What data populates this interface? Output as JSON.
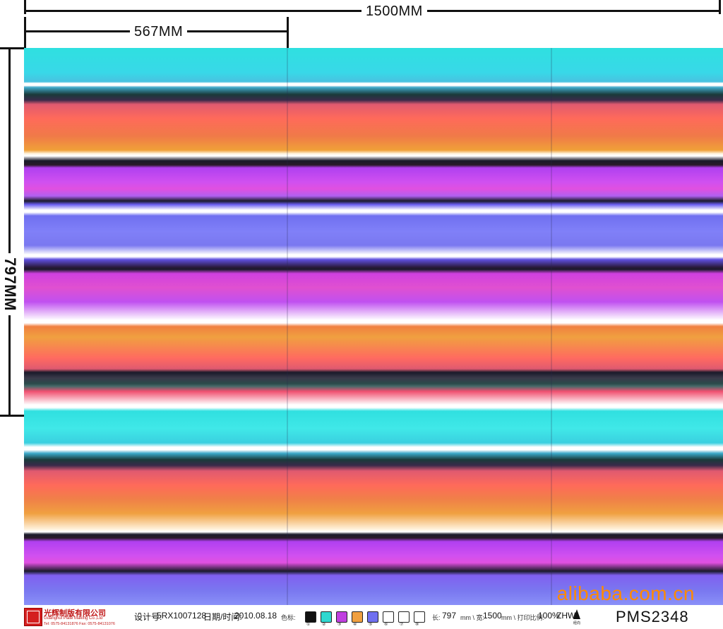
{
  "dimensions": {
    "total_width": "1500MM",
    "repeat_width": "567MM",
    "height": "797MM"
  },
  "watermark": "alibaba.com.cn",
  "footer": {
    "company_cn": "光辉制版有限公司",
    "company_en": "Guanghui Plate Making Co.,Ltd",
    "company_tel": "Tel: 0575-84131876  Fax: 0575-84131076",
    "design_no_label": "设计号:",
    "design_no": "5RX1007128",
    "date_label": "日期/时间:",
    "date": "2010.08.18",
    "colors_label": "色标:",
    "swatches": [
      {
        "num": "①",
        "color": "#111111"
      },
      {
        "num": "②",
        "color": "#30d8d0"
      },
      {
        "num": "③",
        "color": "#c040e0"
      },
      {
        "num": "④",
        "color": "#f0a040"
      },
      {
        "num": "⑤",
        "color": "#7070f0"
      },
      {
        "num": "⑥",
        "color": "#ffffff"
      },
      {
        "num": "⑦",
        "color": "#ffffff"
      },
      {
        "num": "⑧",
        "color": "#ffffff"
      }
    ],
    "length_label": "长:",
    "length": "797",
    "width_unit_label": "mm \\ 宽:",
    "width": "1500",
    "scale_label": "mm \\ 打印比例:",
    "scale": "100%",
    "initials": "ZHW",
    "pointer_caption": "经向",
    "code": "PMS2348"
  }
}
